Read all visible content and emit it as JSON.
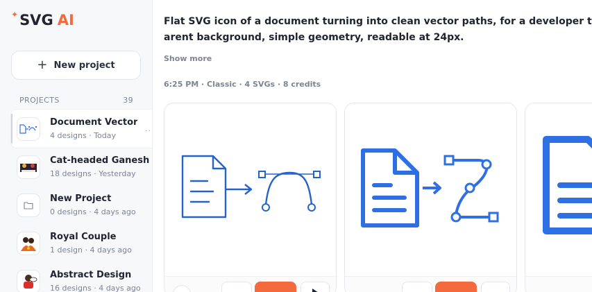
{
  "brand": {
    "name": "SVG",
    "accent": "AI",
    "accent_color": "#f26a3d"
  },
  "sidebar": {
    "new_project_label": "New project",
    "projects_heading": "PROJECTS",
    "projects_count": "39",
    "items": [
      {
        "name": "Document Vector",
        "meta": "4 designs · Today",
        "active": true
      },
      {
        "name": "Cat-headed Ganesh",
        "meta": "18 designs · Yesterday"
      },
      {
        "name": "New Project",
        "meta": "0 designs · 4 days ago"
      },
      {
        "name": "Royal Couple",
        "meta": "1 design · 4 days ago"
      },
      {
        "name": "Abstract Design",
        "meta": "16 designs · 4 days ago"
      }
    ]
  },
  "main": {
    "prompt_line1": "Flat SVG icon of a document turning into clean vector paths, for a developer tool sidebar. Blue strokes on a transp",
    "prompt_line2": "arent background, simple geometry, readable at 24px.",
    "show_more_label": "Show more",
    "generation_meta": "6:25 PM · Classic · 4 SVGs · 8 credits"
  },
  "colors": {
    "icon_blue": "#2f6fe4",
    "outline_blue": "#2563c9",
    "orange": "#f26a3d"
  }
}
